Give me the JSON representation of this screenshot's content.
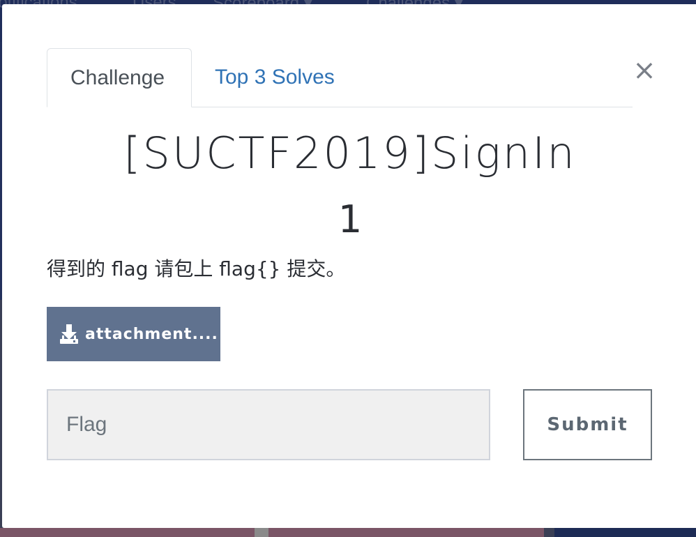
{
  "background_nav": {
    "items": [
      "Notifications",
      "Users",
      "Scoreboard ▾",
      "Challenges ▾"
    ]
  },
  "modal": {
    "close_glyph": "×",
    "tabs": [
      {
        "label": "Challenge",
        "active": true
      },
      {
        "label": "Top 3 Solves",
        "active": false
      }
    ],
    "title": "[SUCTF2019]SignIn",
    "value": "1",
    "description": "得到的 flag 请包上 flag{} 提交。",
    "attachment": {
      "icon": "download-icon",
      "label": "attachment...."
    },
    "flag_input": {
      "value": "",
      "placeholder": "Flag"
    },
    "submit_label": "Submit"
  },
  "colors": {
    "tab_link": "#2f72b5",
    "attachment_button": "#60728f",
    "input_background": "#f0f0f0",
    "backdrop": "#1d2b55"
  }
}
